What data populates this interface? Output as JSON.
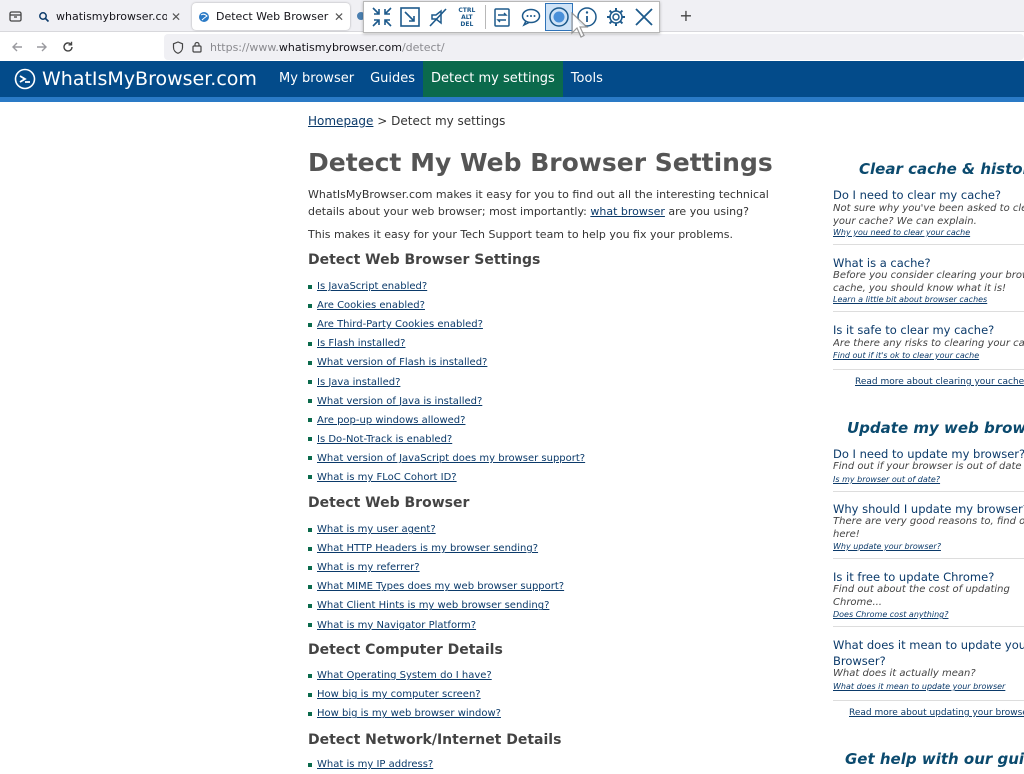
{
  "browser": {
    "tabs": [
      {
        "title": "whatismybrowser.com cl",
        "close": "✕"
      },
      {
        "title": "Detect Web Browser Sett",
        "close": "✕"
      }
    ],
    "newtab": "+",
    "url": {
      "scheme": "https://www.",
      "host": "whatismybrowser.com",
      "path": "/detect/"
    },
    "floating_toolbar": {
      "ctrl_alt_del": [
        "CTRL",
        "ALT",
        "DEL"
      ]
    }
  },
  "site": {
    "logo": "WhatIsMyBrowser.com",
    "nav": [
      "My browser",
      "Guides",
      "Detect my settings",
      "Tools"
    ],
    "active_nav": "Detect my settings"
  },
  "breadcrumb": {
    "home": "Homepage",
    "sep": " > ",
    "current": "Detect my settings"
  },
  "page_title": "Detect My Web Browser Settings",
  "intro": {
    "before": "WhatIsMyBrowser.com makes it easy for you to find out all the interesting technical details about your web browser; most importantly: ",
    "link": "what browser",
    "after": " are you using?"
  },
  "intro2": "This makes it easy for your Tech Support team to help you fix your problems.",
  "sections": [
    {
      "heading": "Detect Web Browser Settings",
      "links": [
        "Is JavaScript enabled?",
        "Are Cookies enabled?",
        "Are Third-Party Cookies enabled?",
        "Is Flash installed?",
        "What version of Flash is installed?",
        "Is Java installed?",
        "What version of Java is installed?",
        "Are pop-up windows allowed?",
        "Is Do-Not-Track is enabled?",
        "What version of JavaScript does my browser support?",
        "What is my FLoC Cohort ID?"
      ]
    },
    {
      "heading": "Detect Web Browser",
      "links": [
        "What is my user agent?",
        "What HTTP Headers is my browser sending?",
        "What is my referrer?",
        "What MIME Types does my web browser support?",
        "What Client Hints is my web browser sending?",
        "What is my Navigator Platform?"
      ]
    },
    {
      "heading": "Detect Computer Details",
      "links": [
        "What Operating System do I have?",
        "How big is my computer screen?",
        "How big is my web browser window?"
      ]
    },
    {
      "heading": "Detect Network/Internet Details",
      "links": [
        "What is my IP address?"
      ]
    }
  ],
  "sidebar": {
    "cache": {
      "heading": "Clear cache & history",
      "items": [
        {
          "q": "Do I need to clear my cache?",
          "d": [
            "Not sure why you've been asked to clear",
            "your cache? We can explain."
          ],
          "l": "Why you need to clear your cache"
        },
        {
          "q": "What is a cache?",
          "d": [
            "Before you consider clearing your browser's",
            "cache, you should know what it is!"
          ],
          "l": "Learn a little bit about browser caches"
        },
        {
          "q": "Is it safe to clear my cache?",
          "d": [
            "Are there any risks to clearing your cache?"
          ],
          "l": "Find out if it's ok to clear your cache"
        }
      ],
      "more": "Read more about clearing your cache"
    },
    "update": {
      "heading": "Update my web browser",
      "items": [
        {
          "q": "Do I need to update my browser?",
          "d": [
            "Find out if your browser is out of date"
          ],
          "l": "Is my browser out of date?"
        },
        {
          "q": "Why should I update my browser?",
          "d": [
            "There are very good reasons to, find out",
            "here!"
          ],
          "l": "Why update your browser?"
        },
        {
          "q": "Is it free to update Chrome?",
          "d": [
            "Find out about the cost of updating",
            "Chrome..."
          ],
          "l": "Does Chrome cost anything?"
        },
        {
          "q": [
            "What does it mean to update your",
            "Browser?"
          ],
          "d": [
            "What does it actually mean?"
          ],
          "l": "What does it mean to update your browser"
        }
      ],
      "more": "Read more about updating your browser"
    },
    "guides": {
      "heading": "Get help with our guides"
    }
  }
}
